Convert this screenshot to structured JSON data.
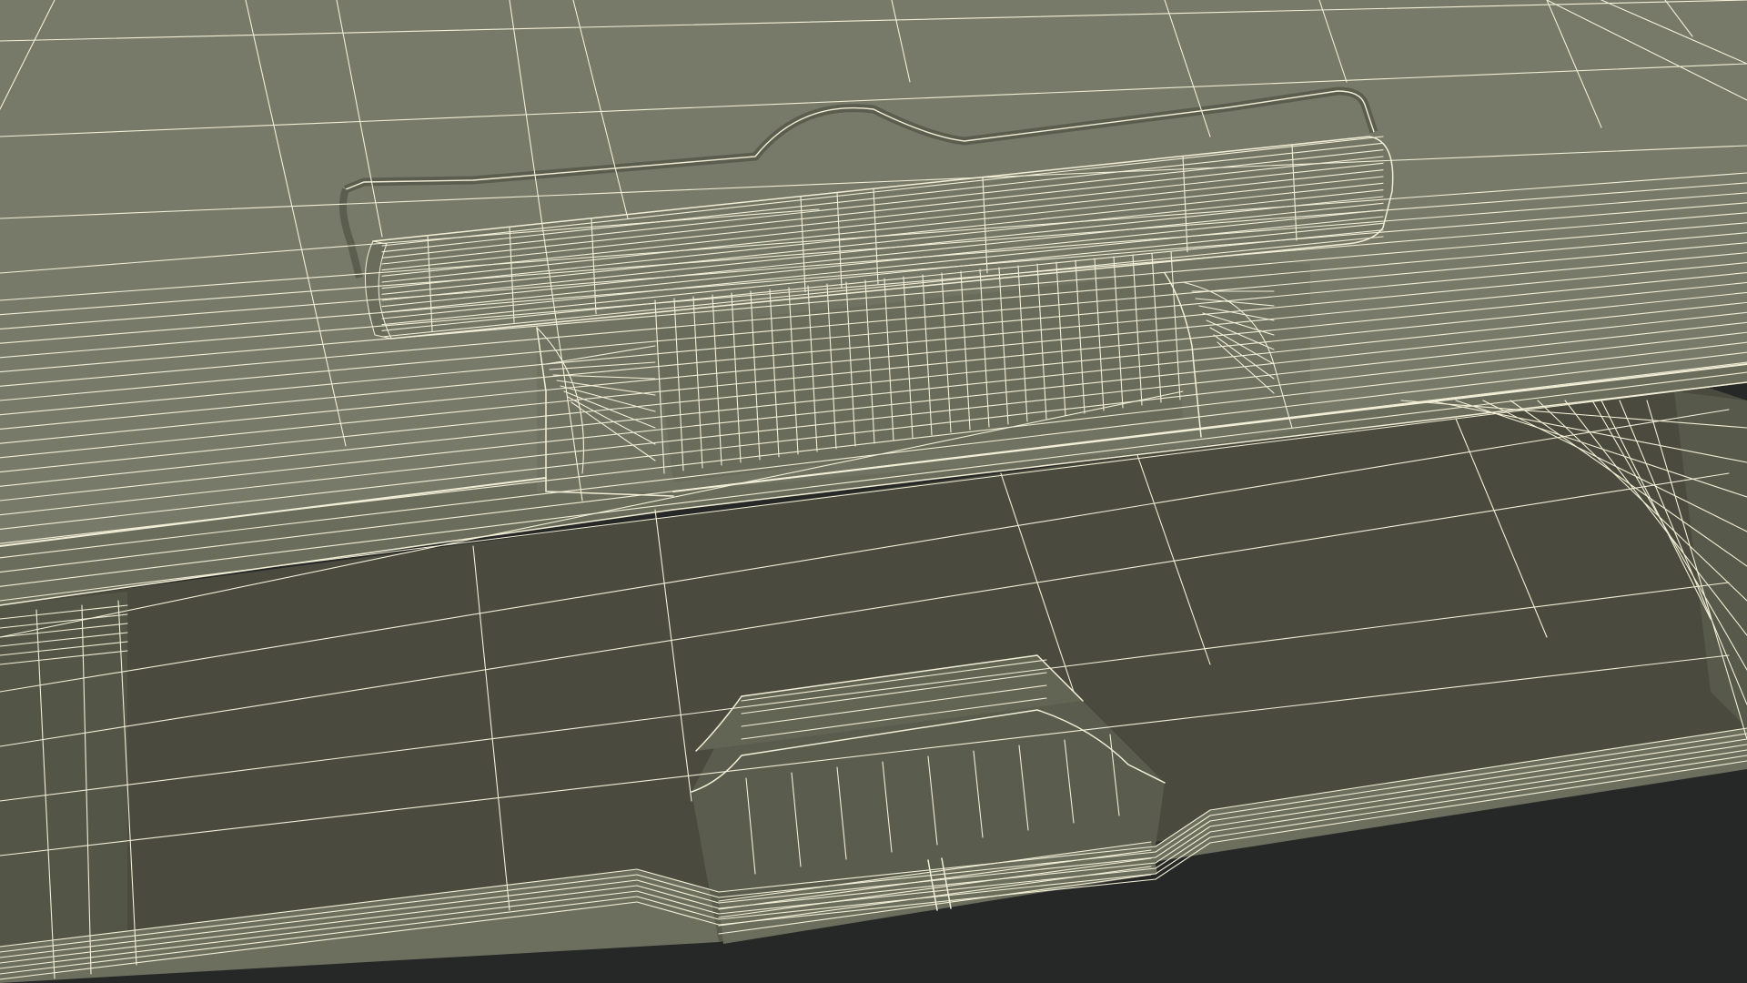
{
  "scene": {
    "subject": "wireframe-render",
    "colors": {
      "background": "#262727",
      "lid_surface": "#787a68",
      "lid_dark": "#6e705f",
      "tray_surface": "#4d4e40",
      "tray_floor": "#44453a",
      "tray_rim": "#6b6d5c",
      "wire": "#f2efd6"
    }
  }
}
